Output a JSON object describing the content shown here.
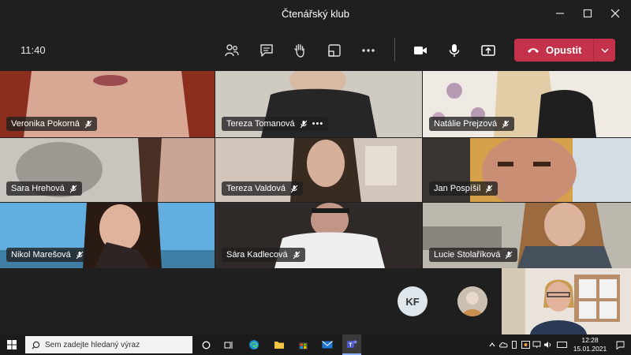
{
  "window": {
    "title": "Čtenářský klub",
    "controls": {
      "minimize": "—",
      "maximize": "☐",
      "close": "✕"
    }
  },
  "toolbar": {
    "time": "11:40",
    "buttons": [
      "people-icon",
      "chat-icon",
      "raise-hand-icon",
      "rooms-icon",
      "more-icon",
      "camera-icon",
      "mic-icon",
      "share-icon"
    ],
    "leave_label": "Opustit"
  },
  "participants": [
    {
      "name": "Veronika Pokorná"
    },
    {
      "name": "Tereza Tomanová",
      "more": "•••"
    },
    {
      "name": "Natálie Prejzová"
    },
    {
      "name": "Sara Hrehová"
    },
    {
      "name": "Tereza Valdová"
    },
    {
      "name": "Jan Pospíšil"
    },
    {
      "name": "Nikol Marešová"
    },
    {
      "name": "Sára Kadlecová"
    },
    {
      "name": "Lucie Stolaříková"
    }
  ],
  "bottom": {
    "initials_avatar": "KF"
  },
  "taskbar": {
    "search_placeholder": "Sem zadejte hledaný výraz",
    "time": "12:28",
    "date": "15.01.2021"
  },
  "colors": {
    "leave_button": "#c4314b",
    "app_background": "#201f1f"
  }
}
